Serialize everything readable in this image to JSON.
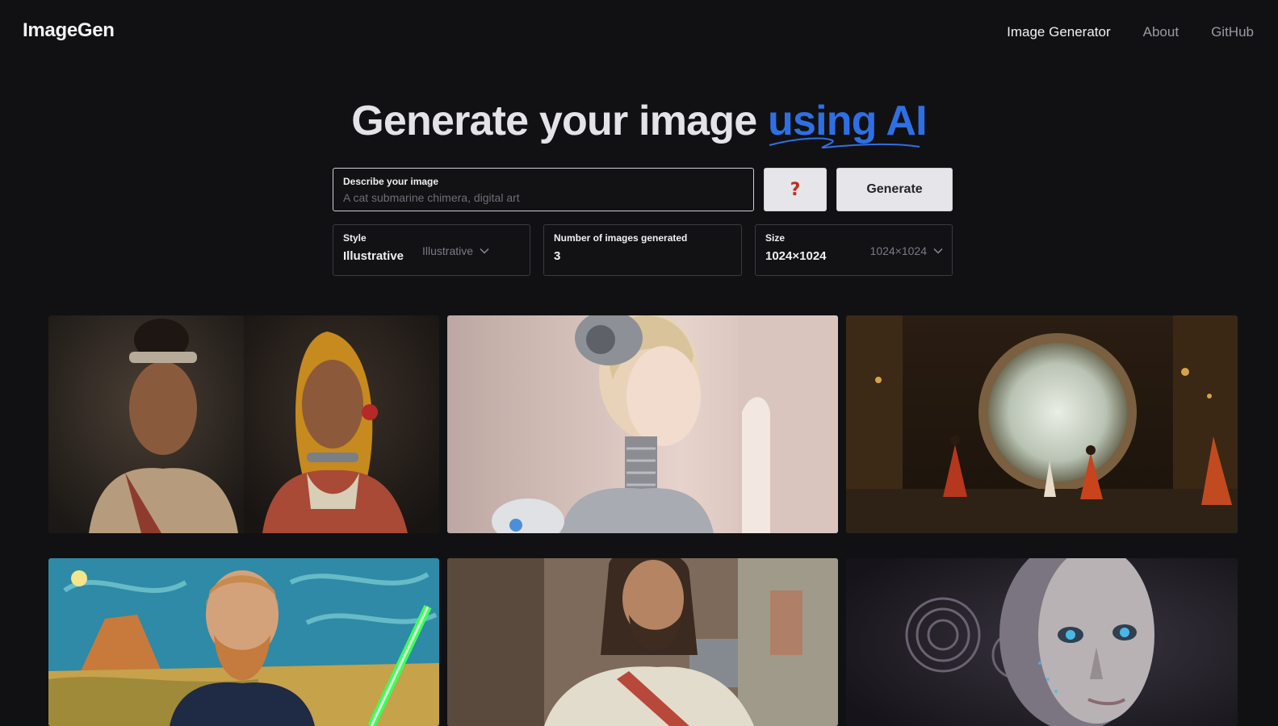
{
  "app": {
    "brand": "ImageGen"
  },
  "nav": {
    "items": [
      "Image Generator",
      "About",
      "GitHub"
    ],
    "active": "Image Generator"
  },
  "hero": {
    "title_main": "Generate your image",
    "title_accent": "using AI"
  },
  "prompt": {
    "label": "Describe your image",
    "placeholder": "A cat submarine chimera, digital art",
    "value": ""
  },
  "buttons": {
    "help_icon": "question-mark",
    "help_glyph": "?",
    "generate_label": "Generate"
  },
  "options": {
    "style": {
      "label": "Style",
      "value": "Illustrative",
      "selected": "Illustrative"
    },
    "count": {
      "label": "Number of images generated",
      "value": "3"
    },
    "size": {
      "label": "Size",
      "value": "1024×1024",
      "selected": "1024×1024"
    }
  },
  "colors": {
    "background": "#111114",
    "accent": "#2f6fe4",
    "help_icon": "#c52a1d"
  }
}
